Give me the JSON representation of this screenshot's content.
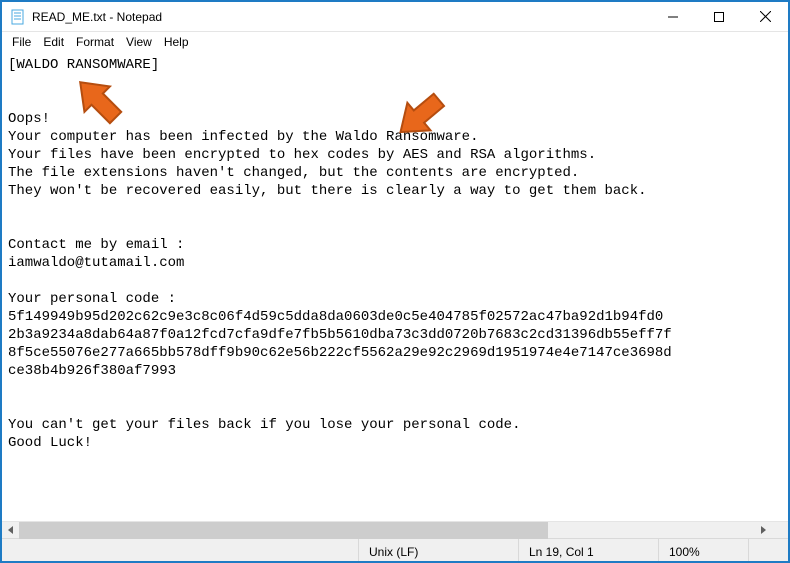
{
  "window": {
    "title": "READ_ME.txt - Notepad"
  },
  "menu": {
    "file": "File",
    "edit": "Edit",
    "format": "Format",
    "view": "View",
    "help": "Help"
  },
  "content": {
    "header": "[WALDO RANSOMWARE]",
    "oops": "Oops!",
    "l1": "Your computer has been infected by the Waldo Ransomware.",
    "l2": "Your files have been encrypted to hex codes by AES and RSA algorithms.",
    "l3": "The file extensions haven't changed, but the contents are encrypted.",
    "l4": "They won't be recovered easily, but there is clearly a way to get them back.",
    "contact_label": "Contact me by email :",
    "email": "iamwaldo@tutamail.com",
    "code_label": "Your personal code :",
    "code1": "5f149949b95d202c62c9e3c8c06f4d59c5dda8da0603de0c5e404785f02572ac47ba92d1b94fd0",
    "code2": "2b3a9234a8dab64a87f0a12fcd7cfa9dfe7fb5b5610dba73c3dd0720b7683c2cd31396db55eff7f",
    "code3": "8f5ce55076e277a665bb578dff9b90c62e56b222cf5562a29e92c2969d1951974e4e7147ce3698d",
    "code4": "ce38b4b926f380af7993",
    "warn": "You can't get your files back if you lose your personal code.",
    "luck": "Good Luck!"
  },
  "status": {
    "encoding": "Unix (LF)",
    "position": "Ln 19, Col 1",
    "zoom": "100%"
  }
}
